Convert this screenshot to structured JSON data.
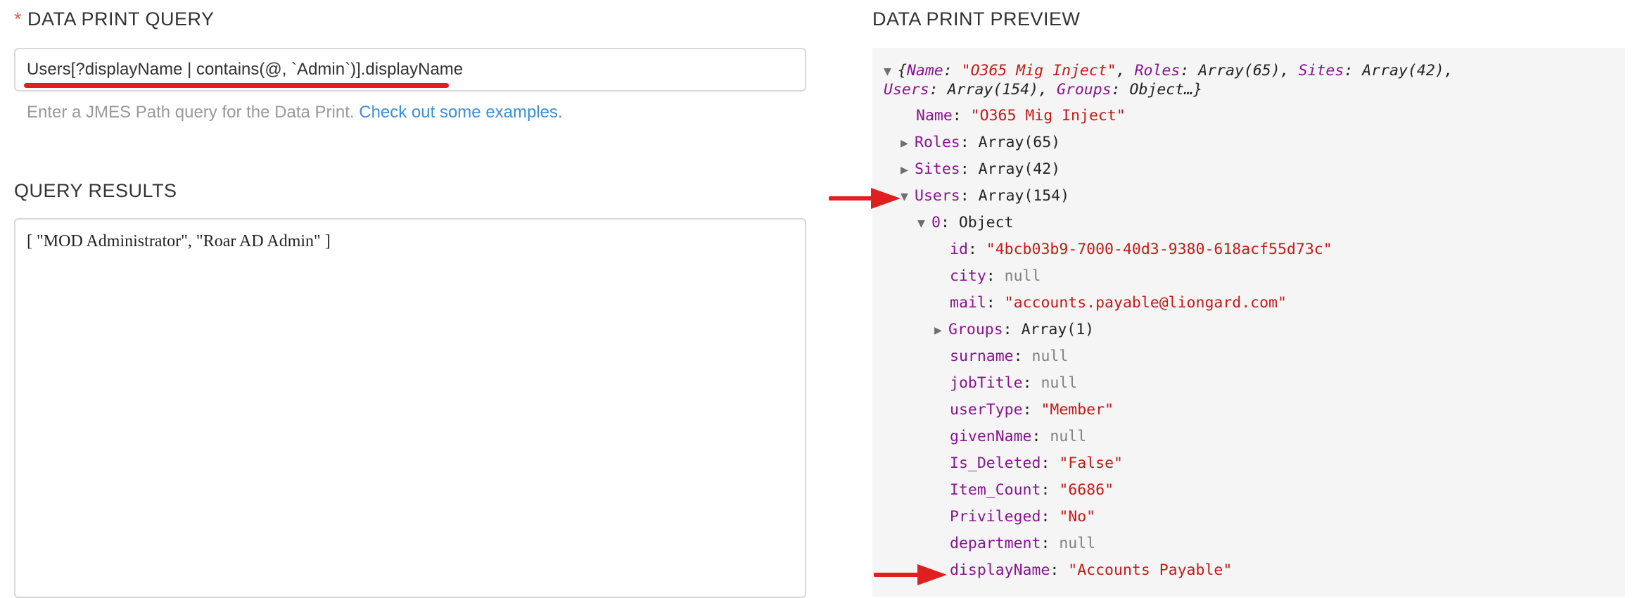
{
  "query_section": {
    "required_mark": "*",
    "title": "DATA PRINT QUERY",
    "input_value": "Users[?displayName | contains(@, `Admin`)].displayName",
    "helper_text": "Enter a JMES Path query for the Data Print.",
    "helper_link": "Check out some examples."
  },
  "results_section": {
    "title": "QUERY RESULTS",
    "result_text": "[ \"MOD Administrator\", \"Roar AD Admin\" ]"
  },
  "preview_section": {
    "title": "DATA PRINT PREVIEW",
    "summary": {
      "open": "{",
      "name_key": "Name",
      "name_value": "\"O365 Mig Inject\"",
      "roles_key": "Roles",
      "roles_value": "Array(65)",
      "sites_key": "Sites",
      "sites_value": "Array(42)",
      "users_key": "Users",
      "users_value": "Array(154)",
      "groups_key": "Groups",
      "groups_value": "Object…}"
    },
    "tree": {
      "name_key": "Name",
      "name_value": "\"O365 Mig Inject\"",
      "roles_key": "Roles",
      "roles_value": "Array(65)",
      "sites_key": "Sites",
      "sites_value": "Array(42)",
      "users_key": "Users",
      "users_value": "Array(154)",
      "item0_key": "0",
      "item0_value": "Object",
      "fields": [
        {
          "key": "id",
          "value": "\"4bcb03b9-7000-40d3-9380-618acf55d73c\"",
          "kind": "string"
        },
        {
          "key": "city",
          "value": "null",
          "kind": "null"
        },
        {
          "key": "mail",
          "value": "\"accounts.payable@liongard.com\"",
          "kind": "string"
        },
        {
          "key": "Groups",
          "value": "Array(1)",
          "kind": "collapsed"
        },
        {
          "key": "surname",
          "value": "null",
          "kind": "null"
        },
        {
          "key": "jobTitle",
          "value": "null",
          "kind": "null"
        },
        {
          "key": "userType",
          "value": "\"Member\"",
          "kind": "string"
        },
        {
          "key": "givenName",
          "value": "null",
          "kind": "null"
        },
        {
          "key": "Is_Deleted",
          "value": "\"False\"",
          "kind": "string"
        },
        {
          "key": "Item_Count",
          "value": "\"6686\"",
          "kind": "string"
        },
        {
          "key": "Privileged",
          "value": "\"No\"",
          "kind": "string"
        },
        {
          "key": "department",
          "value": "null",
          "kind": "null"
        },
        {
          "key": "displayName",
          "value": "\"Accounts Payable\"",
          "kind": "string"
        }
      ]
    },
    "expanded_glyph": "▼",
    "collapsed_glyph": "▶"
  },
  "annotation_color": "#e02020"
}
